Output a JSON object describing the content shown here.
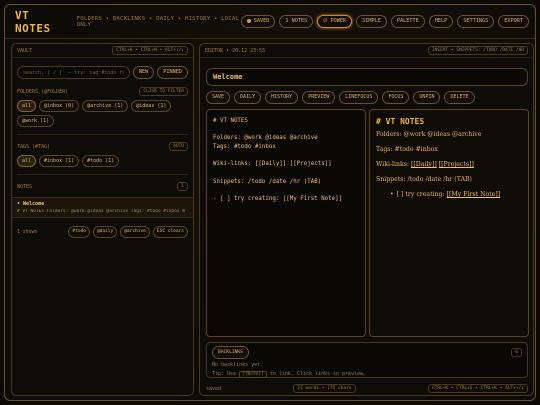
{
  "app": {
    "title": "VT NOTES",
    "subtitle": "FOLDERS • BACKLINKS • DAILY • HISTORY • LOCAL ONLY"
  },
  "topbar": {
    "saved_label": "SAVED",
    "notes_count": "1 NOTES",
    "power_label": "POWER",
    "simple_label": "SIMPLE",
    "palette_label": "PALETTE",
    "help_label": "HELP",
    "settings_label": "SETTINGS",
    "export_label": "EXPORT"
  },
  "vault": {
    "label": "VAULT",
    "shortcut": "CTRL+K • CTRL+N • ALT+↑/↓",
    "search_placeholder": "search, [ / ]  — try: tag:#todo folder:",
    "new_label": "NEW",
    "pinned_label": "PINNED",
    "folders_label": "FOLDERS (@FOLDER)",
    "folders_hint": "CLICK TO FILTER",
    "folders": [
      "all",
      "@inbox (0)",
      "@archive (1)",
      "@ideas (1)",
      "@work (1)"
    ],
    "tags_label": "TAGS (#TAG)",
    "tags_hint": "AUTO",
    "tags": [
      "all",
      "#inbox (1)",
      "#todo (1)"
    ],
    "notes_label": "NOTES",
    "notes_count": "1",
    "notes": [
      {
        "title": "• Welcome",
        "preview": "# VT NOTES Folders: @work @ideas @archive Tags: #todo #inbox W"
      }
    ],
    "footer": {
      "shown": "1 shown",
      "chips": [
        "#todo",
        "@daily",
        "@archive"
      ],
      "esc_label": "ESC clears"
    }
  },
  "editor": {
    "header_label": "EDITOR • 20.12 23:55",
    "header_hint": "INSERT • SNIPPETS: /TODO /DATE /HR",
    "title_value": "Welcome",
    "toolbar": [
      "SAVE",
      "DAILY",
      "HISTORY",
      "PREVIEW",
      "LINEFOCUS",
      "FOCUS",
      "UNPIN",
      "DELETE"
    ],
    "content": "# VT NOTES\n\nFolders: @work @ideas @archive\nTags: #todo #inbox\n\nWiki-links: [[Daily]] [[Projects]]\n\nSnippets: /todo /date /hr (TAB)\n\n- [ ] try creating: [[My First Note]]",
    "preview": {
      "heading": "# VT NOTES",
      "folders": "Folders: @work @ideas @archive",
      "tags": "Tags: #todo #inbox",
      "wiki_prefix": "Wiki-links:",
      "wiki_link1": "[[Daily]]",
      "wiki_link2": "[[Projects]]",
      "snippets": "Snippets: /todo /date /hr (TAB)",
      "task_prefix": "[ ] try creating:",
      "task_link": "[[My First Note]]"
    },
    "backlinks": {
      "label": "BACKLINKS",
      "count": "0",
      "empty": "No backlinks yet.",
      "tip_prefix": "Tip: Use",
      "tip_kbd": "[[Note]]",
      "tip_suffix": "to link. Click links in preview."
    },
    "footer": {
      "status": "saved",
      "stats": "27 words • 175 chars",
      "shortcut": "CTRL+K • CTRL+S • CTRL+K • ALT+↑/↓"
    }
  }
}
